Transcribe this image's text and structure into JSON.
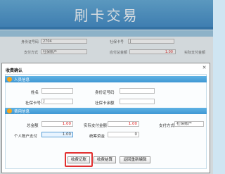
{
  "window": {
    "title": "刷卡交易"
  },
  "background_form": {
    "id_label": "身份证号码",
    "id_value": "2704",
    "card_label": "社保卡号",
    "card_value": "J",
    "row2_left_label": "支付方式",
    "row2_left_value": "社保账户",
    "row2_mid_label": "应付总金额",
    "row2_mid_value": "1.00",
    "row2_right_label": "实际支付金额"
  },
  "dialog": {
    "title": "收费确认",
    "close_icon": "close-icon",
    "personal_section": {
      "title": "人员信息",
      "name_label": "姓名",
      "name_value": "",
      "id_label": "身份证号码",
      "id_value": "",
      "card_label": "社保卡号",
      "card_value": "J",
      "balance_label": "社保卡余额",
      "balance_value": ""
    },
    "fee_section": {
      "title": "费用信息",
      "total_label": "总金额",
      "total_value": "1.00",
      "actual_label": "实际支付金额",
      "actual_value": "1.00",
      "pay_method_label": "支付方式",
      "pay_method_value": "社保账户",
      "personal_pay_label": "个人账户支付",
      "personal_pay_value": "1.00",
      "pool_label": "统筹资金",
      "pool_value": "0"
    },
    "buttons": {
      "confirm": "收费记账",
      "calc": "收费结算",
      "back": "返回重新编辑"
    }
  },
  "colors": {
    "header": "#3c89c7",
    "section_head": "#4aa3da",
    "highlight": "#e23030",
    "amount_red": "#d22222"
  }
}
